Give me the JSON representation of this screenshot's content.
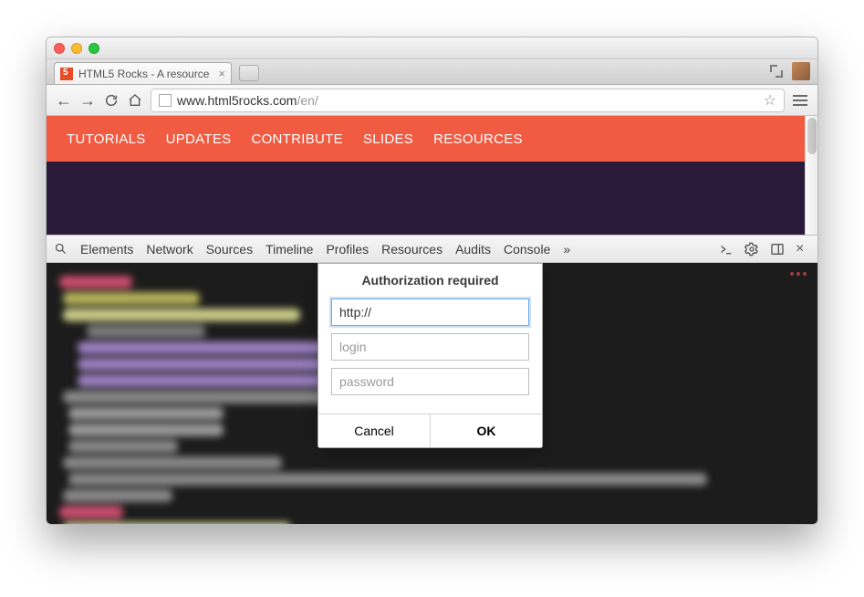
{
  "browser": {
    "tab_title": "HTML5 Rocks - A resource",
    "url_host": "www.html5rocks.com",
    "url_path": "/en/"
  },
  "site_nav": {
    "items": [
      "TUTORIALS",
      "UPDATES",
      "CONTRIBUTE",
      "SLIDES",
      "RESOURCES"
    ]
  },
  "devtools": {
    "tabs": [
      "Elements",
      "Network",
      "Sources",
      "Timeline",
      "Profiles",
      "Resources",
      "Audits",
      "Console"
    ],
    "overflow": "»"
  },
  "auth_dialog": {
    "title": "Authorization required",
    "host_value": "http://",
    "login_placeholder": "login",
    "password_placeholder": "password",
    "cancel": "Cancel",
    "ok": "OK"
  }
}
